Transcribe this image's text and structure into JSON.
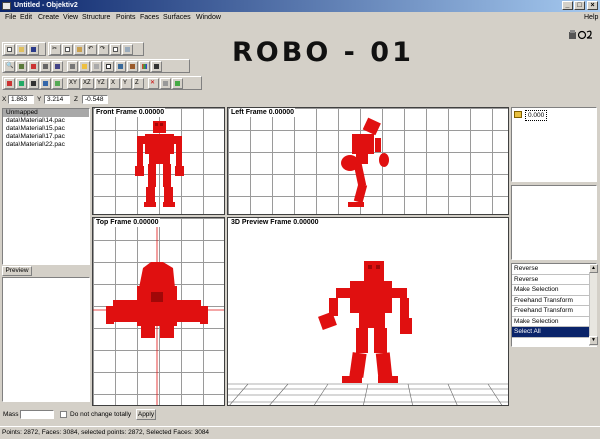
{
  "window": {
    "title": "Untitled - Objektiv2",
    "help_label": "Help"
  },
  "menu": [
    "File",
    "Edit",
    "Create",
    "View",
    "Structure",
    "Points",
    "Faces",
    "Surfaces",
    "Window"
  ],
  "banner": {
    "text": "ROBO - 01"
  },
  "toolbar": {
    "axis_buttons": [
      "XY",
      "XZ",
      "YZ",
      "X",
      "Y",
      "Z"
    ]
  },
  "coords": {
    "x_label": "X",
    "x_value": "1.863",
    "y_label": "Y",
    "y_value": "3.214",
    "z_label": "Z",
    "z_value": "-0.548"
  },
  "materials": {
    "header": "Unmapped",
    "items": [
      "data\\Material\\14.pac",
      "data\\Material\\15.pac",
      "data\\Material\\17.pac",
      "data\\Material\\22.pac"
    ],
    "preview_label": "Preview"
  },
  "viewports": {
    "front": "Front Frame 0.00000",
    "left": "Left Frame 0.00000",
    "top": "Top Frame 0.00000",
    "preview3d": "3D Preview Frame 0.00000"
  },
  "lod": {
    "value": "0.000"
  },
  "history": {
    "items": [
      "Reverse",
      "Reverse",
      "Make Selection",
      "Freehand Transform",
      "Freehand Transform",
      "Make Selection",
      "Select All"
    ],
    "selected_index": 6
  },
  "mass_bar": {
    "mass_label": "Mass",
    "checkbox_label": "Do not change totally",
    "apply_label": "Apply"
  },
  "statusbar": {
    "text": "Points: 2872, Faces: 3084, selected points: 2872, Selected Faces: 3084"
  },
  "colors": {
    "model": "#e01010",
    "title_start": "#0a246a",
    "selection": "#0a246a"
  }
}
